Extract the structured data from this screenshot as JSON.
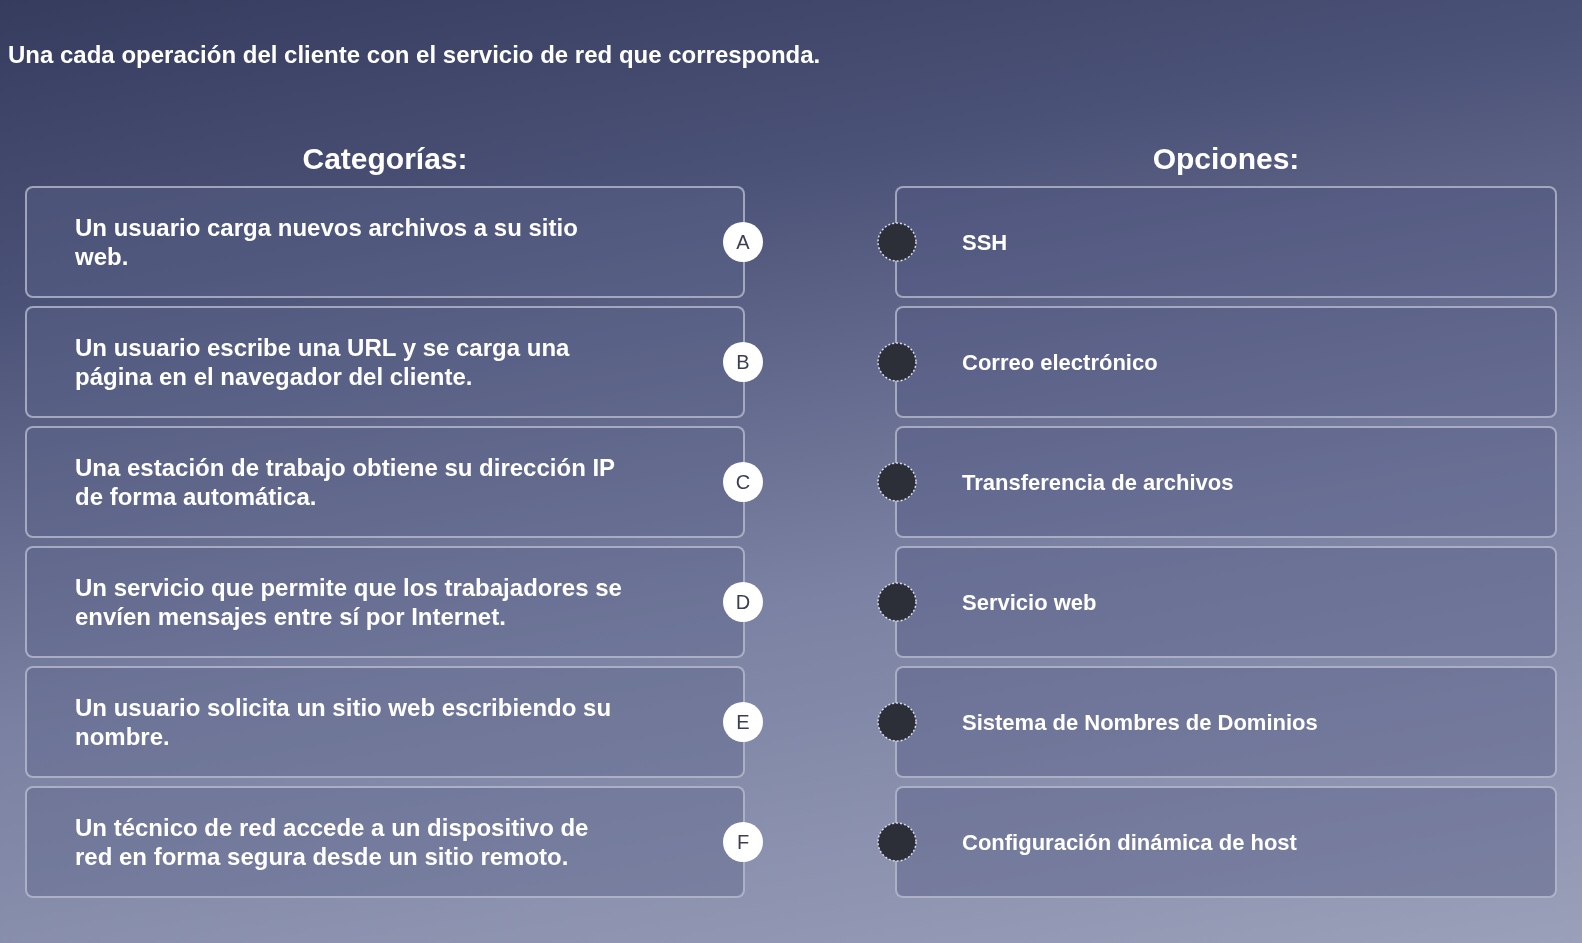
{
  "instruction": "Una cada operación del cliente con el servicio de red que corresponda.",
  "categories": {
    "heading": "Categorías:",
    "items": [
      {
        "text": "Un usuario carga nuevos archivos a su sitio web.",
        "letter": "A"
      },
      {
        "text": "Un usuario escribe una URL y se carga una página en el navegador del cliente.",
        "letter": "B"
      },
      {
        "text": "Una estación de trabajo obtiene su dirección IP de forma automática.",
        "letter": "C"
      },
      {
        "text": "Un servicio que permite que los trabajadores se envíen mensajes entre sí por Internet.",
        "letter": "D"
      },
      {
        "text": "Un usuario solicita un sitio web escribiendo su nombre.",
        "letter": "E"
      },
      {
        "text": "Un técnico de red accede a un dispositivo de red en forma segura desde un sitio remoto.",
        "letter": "F"
      }
    ]
  },
  "options": {
    "heading": "Opciones:",
    "items": [
      {
        "text": "SSH"
      },
      {
        "text": "Correo electrónico"
      },
      {
        "text": "Transferencia de archivos"
      },
      {
        "text": "Servicio web"
      },
      {
        "text": "Sistema de Nombres de Dominios"
      },
      {
        "text": "Configuración dinámica de host"
      }
    ]
  }
}
